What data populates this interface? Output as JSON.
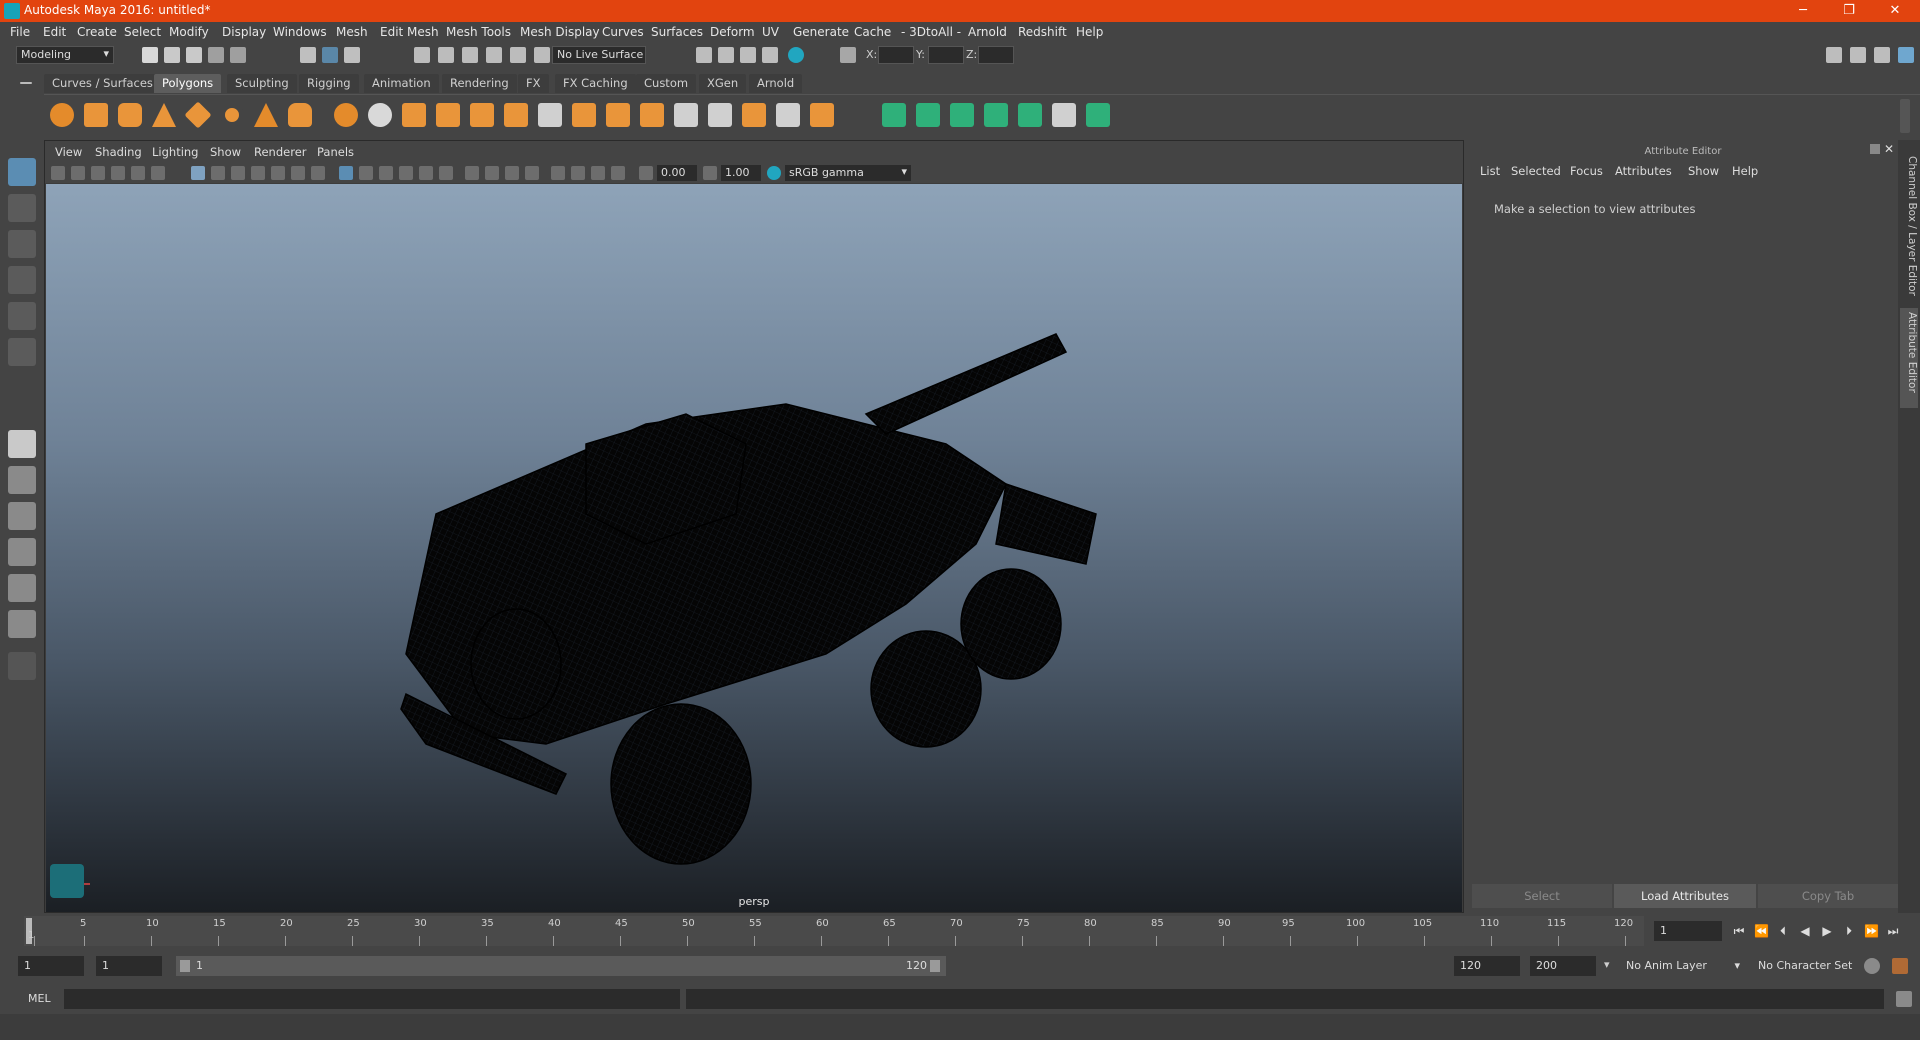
{
  "window": {
    "title": "Autodesk Maya 2016: untitled*",
    "minimize": "─",
    "restore": "❐",
    "close": "✕"
  },
  "menubar": [
    "File",
    "Edit",
    "Create",
    "Select",
    "Modify",
    "Display",
    "Windows",
    "Mesh",
    "Edit Mesh",
    "Mesh Tools",
    "Mesh Display",
    "Curves",
    "Surfaces",
    "Deform",
    "UV",
    "Generate",
    "Cache",
    "- 3DtoAll -",
    "Arnold",
    "Redshift",
    "Help"
  ],
  "statusline": {
    "menuset": "Modeling",
    "live_surface": "No Live Surface",
    "x_label": "X:",
    "y_label": "Y:",
    "z_label": "Z:"
  },
  "shelf": {
    "tabs": [
      "Curves / Surfaces",
      "Polygons",
      "Sculpting",
      "Rigging",
      "Animation",
      "Rendering",
      "FX",
      "FX Caching",
      "Custom",
      "XGen",
      "Arnold"
    ],
    "active_tab": "Polygons"
  },
  "viewport": {
    "menus": [
      "View",
      "Shading",
      "Lighting",
      "Show",
      "Renderer",
      "Panels"
    ],
    "exposure": "0.00",
    "gamma": "1.00",
    "color_space": "sRGB gamma",
    "camera": "persp"
  },
  "attribute_editor": {
    "header": "Attribute Editor",
    "menus": [
      "List",
      "Selected",
      "Focus",
      "Attributes",
      "Show",
      "Help"
    ],
    "message": "Make a selection to view attributes",
    "buttons": {
      "select": "Select",
      "load": "Load Attributes",
      "copy": "Copy Tab"
    }
  },
  "side_tabs": [
    "Channel Box / Layer Editor",
    "Attribute Editor"
  ],
  "timeline": {
    "labels": [
      "5",
      "10",
      "15",
      "20",
      "25",
      "30",
      "35",
      "40",
      "45",
      "50",
      "55",
      "60",
      "65",
      "70",
      "75",
      "80",
      "85",
      "90",
      "95",
      "100",
      "105",
      "110",
      "115",
      "120"
    ],
    "start_marker": "1",
    "current_frame": "1"
  },
  "range": {
    "start": "1",
    "playback_start": "1",
    "slider_start": "1",
    "slider_end": "120",
    "playback_end": "120",
    "end": "200",
    "anim_layer": "No Anim Layer",
    "character_set": "No Character Set"
  },
  "command": {
    "lang": "MEL"
  },
  "colors": {
    "titlebar": "#e2440f",
    "accent": "#18a3b8",
    "active_tab": "#5d5d5d"
  }
}
